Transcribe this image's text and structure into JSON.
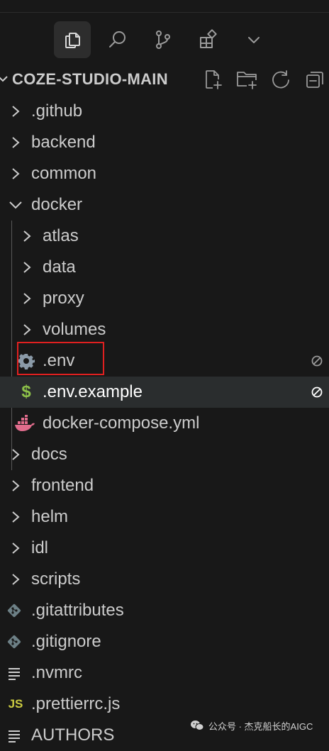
{
  "activity_bar": {
    "items": [
      {
        "icon": "files-icon",
        "active": true
      },
      {
        "icon": "search-icon",
        "active": false
      },
      {
        "icon": "source-control-icon",
        "active": false
      },
      {
        "icon": "extensions-icon",
        "active": false
      },
      {
        "icon": "chevron-down-icon",
        "active": false
      }
    ]
  },
  "explorer": {
    "title": "COZE-STUDIO-MAIN",
    "actions": [
      "new-file-icon",
      "new-folder-icon",
      "refresh-icon",
      "collapse-all-icon"
    ]
  },
  "tree": [
    {
      "label": ".github",
      "type": "folder",
      "expanded": false,
      "depth": 0
    },
    {
      "label": "backend",
      "type": "folder",
      "expanded": false,
      "depth": 0
    },
    {
      "label": "common",
      "type": "folder",
      "expanded": false,
      "depth": 0
    },
    {
      "label": "docker",
      "type": "folder",
      "expanded": true,
      "depth": 0
    },
    {
      "label": "atlas",
      "type": "folder",
      "expanded": false,
      "depth": 1
    },
    {
      "label": "data",
      "type": "folder",
      "expanded": false,
      "depth": 1
    },
    {
      "label": "proxy",
      "type": "folder",
      "expanded": false,
      "depth": 1
    },
    {
      "label": "volumes",
      "type": "folder",
      "expanded": false,
      "depth": 1
    },
    {
      "label": ".env",
      "type": "file",
      "icon": "gear-icon",
      "depth": 1,
      "ignored": true,
      "highlighted": true
    },
    {
      "label": ".env.example",
      "type": "file",
      "icon": "dollar-icon",
      "depth": 1,
      "ignored": true,
      "selected": true
    },
    {
      "label": "docker-compose.yml",
      "type": "file",
      "icon": "docker-icon",
      "depth": 1
    },
    {
      "label": "docs",
      "type": "folder",
      "expanded": false,
      "depth": 0
    },
    {
      "label": "frontend",
      "type": "folder",
      "expanded": false,
      "depth": 0
    },
    {
      "label": "helm",
      "type": "folder",
      "expanded": false,
      "depth": 0
    },
    {
      "label": "idl",
      "type": "folder",
      "expanded": false,
      "depth": 0
    },
    {
      "label": "scripts",
      "type": "folder",
      "expanded": false,
      "depth": 0
    },
    {
      "label": ".gitattributes",
      "type": "file",
      "icon": "git-icon",
      "depth": 0
    },
    {
      "label": ".gitignore",
      "type": "file",
      "icon": "git-icon",
      "depth": 0
    },
    {
      "label": ".nvmrc",
      "type": "file",
      "icon": "lines-icon",
      "depth": 0
    },
    {
      "label": ".prettierrc.js",
      "type": "file",
      "icon": "js-icon",
      "depth": 0
    },
    {
      "label": "AUTHORS",
      "type": "file",
      "icon": "lines-icon",
      "depth": 0
    }
  ],
  "watermark": {
    "icon": "wechat-icon",
    "text": "公众号 · 杰克船长的AIGC"
  },
  "colors": {
    "background": "#181818",
    "selected_row": "#2a2d2e",
    "highlight_box": "#e02020",
    "gear": "#8a9aa8",
    "dollar": "#8dc149",
    "docker": "#e06c8c",
    "git": "#6d8086",
    "js": "#cbcb41"
  }
}
